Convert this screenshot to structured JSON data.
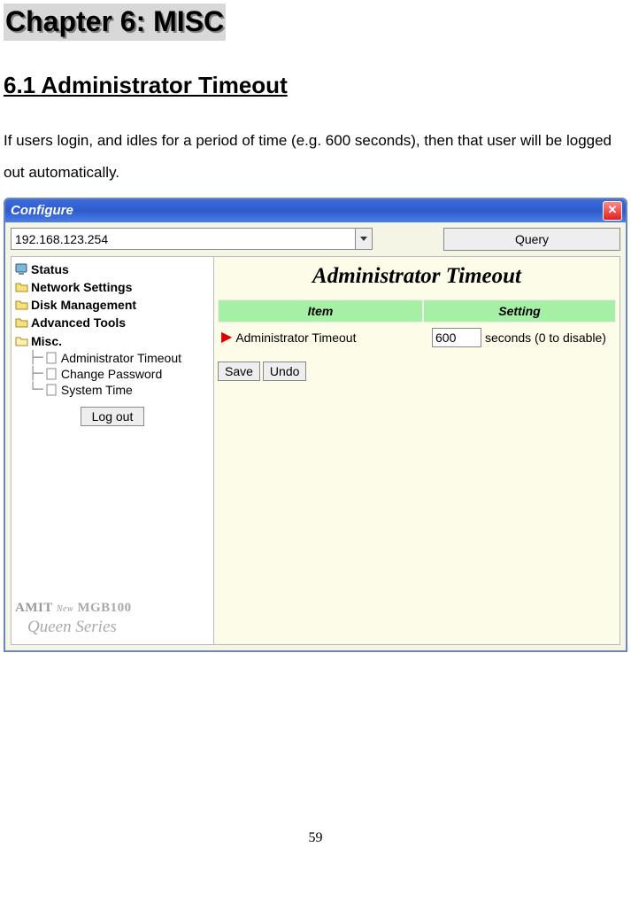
{
  "chapter": "Chapter 6: MISC",
  "section": "6.1 Administrator Timeout",
  "body": "If users login, and idles for a period of time (e.g. 600 seconds), then that user will be logged out automatically.",
  "window": {
    "title": "Configure",
    "ip": "192.168.123.254",
    "query": "Query"
  },
  "tree": {
    "status": "Status",
    "network": "Network Settings",
    "disk": "Disk Management",
    "advanced": "Advanced Tools",
    "misc": "Misc.",
    "misc_items": {
      "admin": "Administrator Timeout",
      "pwd": "Change Password",
      "time": "System Time"
    },
    "logout": "Log out"
  },
  "brand": {
    "line1a": "AMIT",
    "line1b": "New",
    "line1c": "MGB100",
    "line2": "Queen Series"
  },
  "panel": {
    "title": "Administrator Timeout",
    "col1": "Item",
    "col2": "Setting",
    "row_label": "Administrator Timeout",
    "timeout_value": "600",
    "timeout_hint": "seconds (0 to disable)",
    "save": "Save",
    "undo": "Undo"
  },
  "page": "59"
}
